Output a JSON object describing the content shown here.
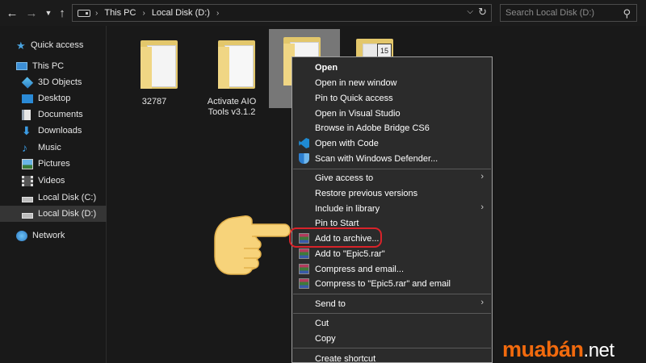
{
  "address": {
    "crumbs": [
      "This PC",
      "Local Disk (D:)"
    ]
  },
  "search": {
    "placeholder": "Search Local Disk (D:)"
  },
  "sidebar": {
    "items": [
      {
        "label": "Quick access",
        "icon": "star-icon"
      },
      {
        "label": "This PC",
        "icon": "computer-icon"
      },
      {
        "label": "3D Objects",
        "icon": "cube-icon"
      },
      {
        "label": "Desktop",
        "icon": "desktop-icon"
      },
      {
        "label": "Documents",
        "icon": "document-icon"
      },
      {
        "label": "Downloads",
        "icon": "download-icon"
      },
      {
        "label": "Music",
        "icon": "music-icon"
      },
      {
        "label": "Pictures",
        "icon": "picture-icon"
      },
      {
        "label": "Videos",
        "icon": "video-icon"
      },
      {
        "label": "Local Disk (C:)",
        "icon": "drive-icon"
      },
      {
        "label": "Local Disk (D:)",
        "icon": "drive-icon",
        "selected": true
      },
      {
        "label": "Network",
        "icon": "network-icon"
      }
    ]
  },
  "files": [
    {
      "label": "32787"
    },
    {
      "label": "Activate AIO Tools v3.1.2"
    },
    {
      "label": "",
      "selected": true
    },
    {
      "label": ""
    }
  ],
  "context_menu": {
    "items": [
      {
        "label": "Open",
        "bold": true
      },
      {
        "label": "Open in new window"
      },
      {
        "label": "Pin to Quick access"
      },
      {
        "label": "Open in Visual Studio"
      },
      {
        "label": "Browse in Adobe Bridge CS6"
      },
      {
        "label": "Open with Code",
        "icon": "vscode-icon"
      },
      {
        "label": "Scan with Windows Defender...",
        "icon": "defender-shield-icon"
      },
      {
        "label": "Give access to",
        "submenu": true
      },
      {
        "label": "Restore previous versions"
      },
      {
        "label": "Include in library",
        "submenu": true
      },
      {
        "label": "Pin to Start"
      },
      {
        "label": "Add to archive...",
        "icon": "winrar-icon",
        "highlighted": true
      },
      {
        "label": "Add to \"Epic5.rar\"",
        "icon": "winrar-icon"
      },
      {
        "label": "Compress and email...",
        "icon": "winrar-icon"
      },
      {
        "label": "Compress to \"Epic5.rar\" and email",
        "icon": "winrar-icon"
      },
      {
        "label": "Send to",
        "submenu": true
      },
      {
        "label": "Cut"
      },
      {
        "label": "Copy"
      },
      {
        "label": "Create shortcut"
      }
    ]
  },
  "overlay": {
    "pointer": "pointing-hand-icon",
    "highlight_color": "#d8232a"
  },
  "watermark": {
    "brand": "muabán",
    "tld": ".net",
    "color": "#f26a0d"
  }
}
